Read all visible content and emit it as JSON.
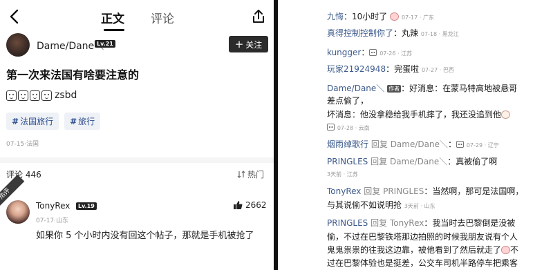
{
  "post": {
    "tabs": [
      "正文",
      "评论"
    ],
    "author": {
      "name": "Dame/Dane＼",
      "level": "Lv.21"
    },
    "follow_label": "关注",
    "title": "第一次来法国有啥要注意的",
    "body_text": "zsbd",
    "tags": [
      "法国旅行",
      "旅行"
    ],
    "meta": "07-15·法国",
    "comments_label": "评论 446",
    "sort_label": "热门",
    "hot_badge": "热评",
    "top_comment": {
      "author": "TonyRex",
      "level": "Lv.19",
      "likes": "2662",
      "meta": "07-17·山东",
      "text": "如果你 5 个小时内没有回这个帖子，那就是手机被抢了"
    }
  },
  "thread": {
    "c1": {
      "name": "九悔",
      "text": "10小时了",
      "meta": "07-17 · 广东"
    },
    "c2": {
      "name": "真得控制控制你了",
      "text": "丸辣",
      "meta": "07-18 · 黑龙江"
    },
    "c3": {
      "name": "kungger",
      "meta": "07-26 · 江苏"
    },
    "c4": {
      "name": "玩家21924948",
      "text": "完蛋啦",
      "meta": "07-27 · 巴西"
    },
    "c5": {
      "name": "Dame/Dane＼",
      "badge": "作者",
      "line1": "好消息：在蒙马特高地被悬哥",
      "line2": "差点偷了，",
      "line3": "坏消息：他没拿稳给我手机摔了，我还没追到他",
      "meta": "07-28 · 云南"
    },
    "c6": {
      "name": "烟雨绰歌行",
      "reply": "回复",
      "to": "Dame/Dane＼",
      "meta": "07-29 · 辽宁"
    },
    "c7": {
      "name": "PRINGLES",
      "reply": "回复",
      "to": "Dame/Dane＼",
      "text": "真被偷了啊",
      "meta": "3天前 · 江苏"
    },
    "c8": {
      "name": "TonyRex",
      "reply": "回复",
      "to": "PRINGLES",
      "line1": "当然啊，那可是法国啊，",
      "line2": "与其说偷不如说明抢",
      "meta": "3天前 · 山东"
    },
    "c9": {
      "name": "PRINGLES",
      "reply": "回复",
      "to": "TonyRex",
      "line1": "我当时去巴黎倒是没被",
      "line2": "偷，不过在巴黎铁塔那边拍照的时候我朋友说有个人",
      "line3": "鬼鬼祟祟的往我这边靠，被他看到了然后就走了",
      "line3b": "不",
      "line4": "过在巴黎体验也是挺差，公交车司机半路停车把乘客"
    }
  }
}
